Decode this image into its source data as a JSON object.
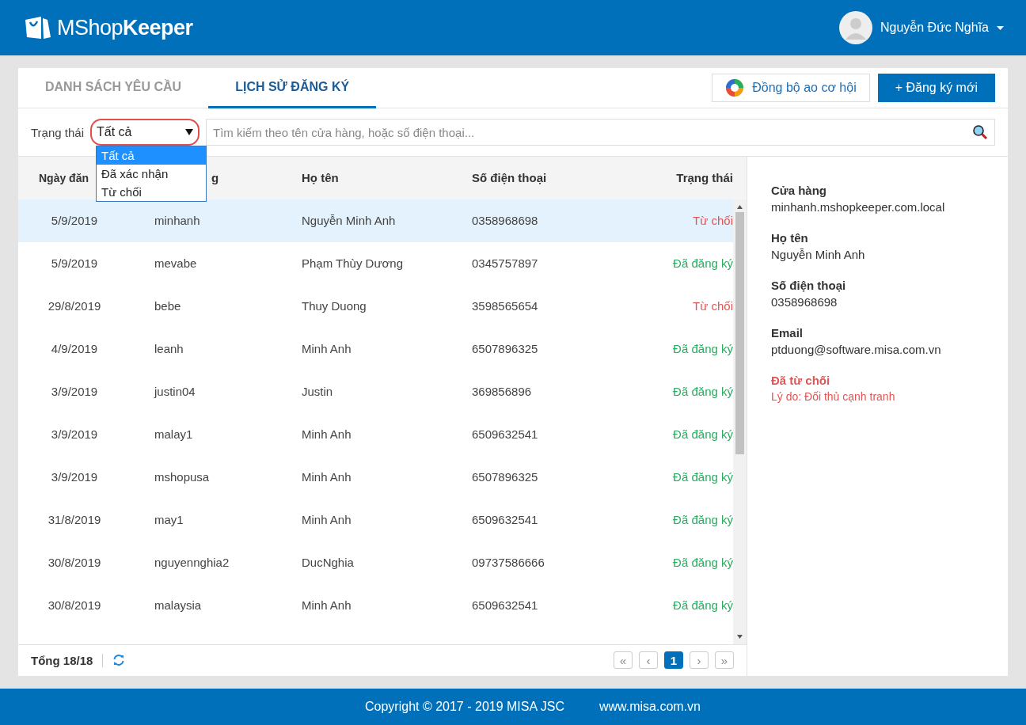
{
  "header": {
    "logo_light": "MShop",
    "logo_bold": "Keeper",
    "user_name": "Nguyễn Đức Nghĩa"
  },
  "tabs": [
    {
      "label": "DANH SÁCH YÊU CẦU",
      "selected": false
    },
    {
      "label": "LỊCH SỬ ĐĂNG KÝ",
      "selected": true
    }
  ],
  "actions": {
    "sync_button": "Đồng bộ ao cơ hội",
    "new_button": "+ Đăng ký mới"
  },
  "filter": {
    "label": "Trạng thái",
    "value": "Tất cả",
    "options": [
      {
        "label": "Tất cả",
        "selected": true
      },
      {
        "label": "Đã xác nhận",
        "selected": false
      },
      {
        "label": "Từ chối",
        "selected": false
      }
    ],
    "search_placeholder": "Tìm kiếm theo tên cửa hàng, hoặc số điện thoại..."
  },
  "table": {
    "columns": [
      "Ngày đăn",
      "g",
      "Họ tên",
      "Số điện thoại",
      "Trạng thái"
    ],
    "rows": [
      {
        "date": "5/9/2019",
        "shop": "minhanh",
        "name": "Nguyễn Minh Anh",
        "phone": "0358968698",
        "status": "Từ chối",
        "kind": "rejected",
        "selected": true
      },
      {
        "date": "5/9/2019",
        "shop": "mevabe",
        "name": "Phạm Thùy Dương",
        "phone": "0345757897",
        "status": "Đã đăng ký",
        "kind": "registered",
        "selected": false
      },
      {
        "date": "29/8/2019",
        "shop": "bebe",
        "name": "Thuy Duong",
        "phone": "3598565654",
        "status": "Từ chối",
        "kind": "rejected",
        "selected": false
      },
      {
        "date": "4/9/2019",
        "shop": "leanh",
        "name": "Minh Anh",
        "phone": "6507896325",
        "status": "Đã đăng ký",
        "kind": "registered",
        "selected": false
      },
      {
        "date": "3/9/2019",
        "shop": "justin04",
        "name": "Justin",
        "phone": "369856896",
        "status": "Đã đăng ký",
        "kind": "registered",
        "selected": false
      },
      {
        "date": "3/9/2019",
        "shop": "malay1",
        "name": "Minh Anh",
        "phone": "6509632541",
        "status": "Đã đăng ký",
        "kind": "registered",
        "selected": false
      },
      {
        "date": "3/9/2019",
        "shop": "mshopusa",
        "name": "Minh Anh",
        "phone": "6507896325",
        "status": "Đã đăng ký",
        "kind": "registered",
        "selected": false
      },
      {
        "date": "31/8/2019",
        "shop": "may1",
        "name": "Minh Anh",
        "phone": "6509632541",
        "status": "Đã đăng ký",
        "kind": "registered",
        "selected": false
      },
      {
        "date": "30/8/2019",
        "shop": "nguyennghia2",
        "name": "DucNghia",
        "phone": "09737586666",
        "status": "Đã đăng ký",
        "kind": "registered",
        "selected": false
      },
      {
        "date": "30/8/2019",
        "shop": "malaysia",
        "name": "Minh Anh",
        "phone": "6509632541",
        "status": "Đã đăng ký",
        "kind": "registered",
        "selected": false
      }
    ]
  },
  "pager": {
    "total": "Tổng 18/18",
    "buttons": [
      {
        "label": "«",
        "selected": false
      },
      {
        "label": "‹",
        "selected": false
      },
      {
        "label": "1",
        "selected": true
      },
      {
        "label": "›",
        "selected": false
      },
      {
        "label": "»",
        "selected": false
      }
    ]
  },
  "detail": {
    "fields": [
      {
        "label": "Cửa hàng",
        "value": "minhanh.mshopkeeper.com.local"
      },
      {
        "label": "Họ tên",
        "value": "Nguyễn Minh Anh"
      },
      {
        "label": "Số điện thoại",
        "value": "0358968698"
      },
      {
        "label": "Email",
        "value": "ptduong@software.misa.com.vn"
      }
    ],
    "status_title": "Đã từ chối",
    "reason": "Lý do: Đối thủ cạnh tranh"
  },
  "footer": {
    "copyright": "Copyright © 2017 - 2019 MISA JSC",
    "website": "www.misa.com.vn"
  }
}
